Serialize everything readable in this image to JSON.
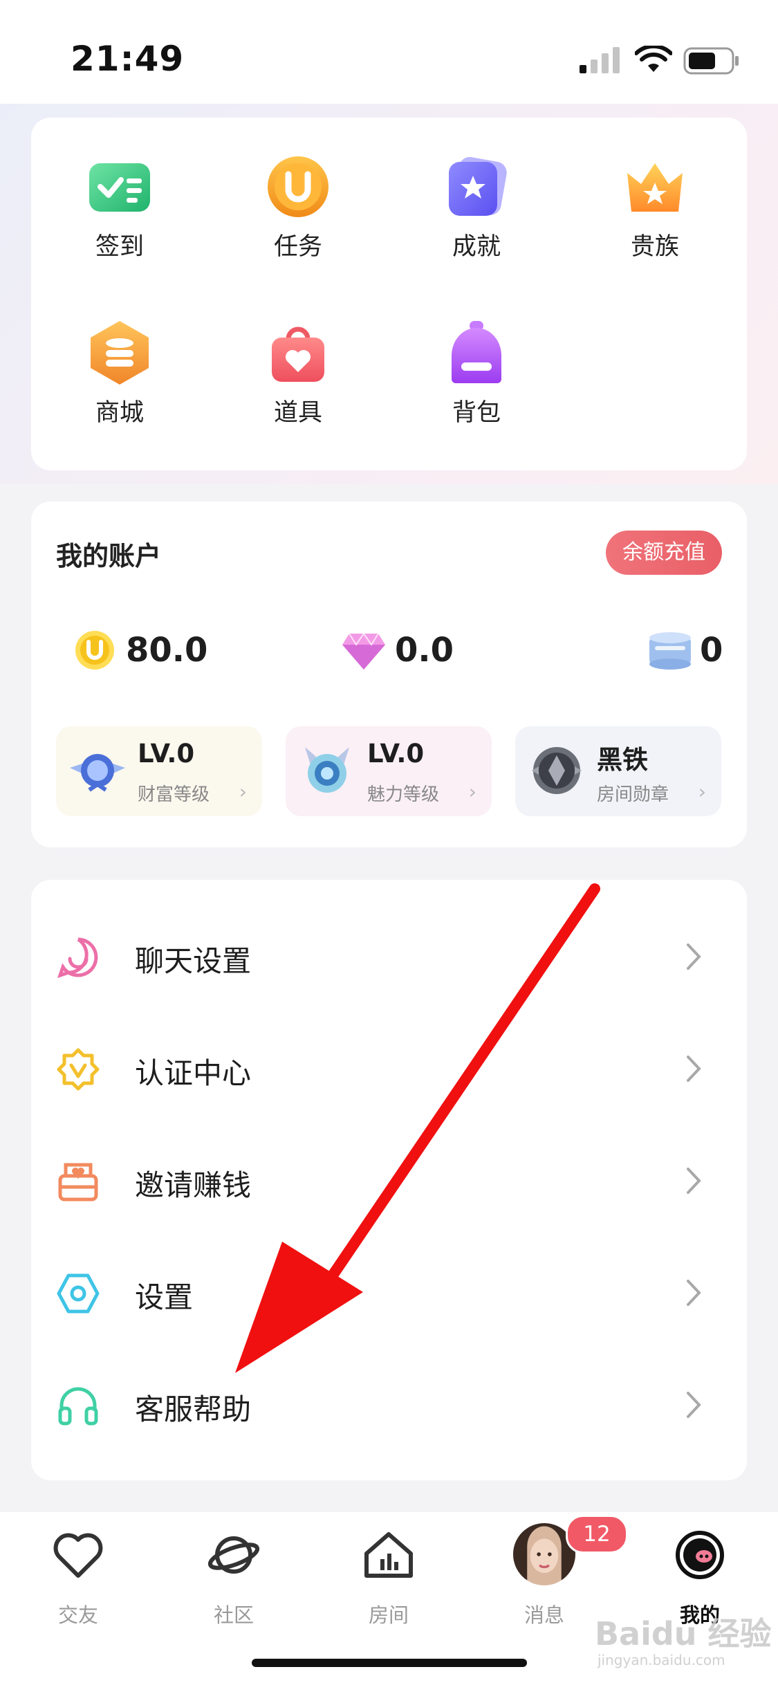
{
  "status_bar": {
    "time": "21:49"
  },
  "quick_grid": [
    {
      "label": "签到",
      "icon": "check-card-icon"
    },
    {
      "label": "任务",
      "icon": "u-coin-icon"
    },
    {
      "label": "成就",
      "icon": "star-badge-icon"
    },
    {
      "label": "贵族",
      "icon": "crown-icon"
    },
    {
      "label": "商城",
      "icon": "coin-stack-icon"
    },
    {
      "label": "道具",
      "icon": "heart-bag-icon"
    },
    {
      "label": "背包",
      "icon": "backpack-icon"
    }
  ],
  "account": {
    "title": "我的账户",
    "recharge_label": "余额充值",
    "balances": [
      {
        "icon": "gold-coin-icon",
        "value": "80.0"
      },
      {
        "icon": "diamond-icon",
        "value": "0.0"
      },
      {
        "icon": "silver-coin-icon",
        "value": "0"
      }
    ],
    "levels": [
      {
        "title": "LV.0",
        "subtitle": "财富等级"
      },
      {
        "title": "LV.0",
        "subtitle": "魅力等级"
      },
      {
        "title": "黑铁",
        "subtitle": "房间勋章"
      }
    ]
  },
  "settings_list": [
    {
      "label": "聊天设置",
      "icon": "smile-chat-icon"
    },
    {
      "label": "认证中心",
      "icon": "verified-badge-icon"
    },
    {
      "label": "邀请赚钱",
      "icon": "envelope-heart-icon"
    },
    {
      "label": "设置",
      "icon": "hex-settings-icon"
    },
    {
      "label": "客服帮助",
      "icon": "headset-icon"
    }
  ],
  "tab_bar": [
    {
      "label": "交友",
      "icon": "heart-icon",
      "active": false
    },
    {
      "label": "社区",
      "icon": "planet-icon",
      "active": false
    },
    {
      "label": "房间",
      "icon": "house-chart-icon",
      "active": false
    },
    {
      "label": "消息",
      "icon": "avatar-photo-icon",
      "active": false,
      "badge": "12"
    },
    {
      "label": "我的",
      "icon": "pig-face-icon",
      "active": true
    }
  ],
  "watermark": {
    "text": "Baidu 经验",
    "sub": "jingyan.baidu.com"
  },
  "colors": {
    "accent_red": "#e95f67",
    "badge_red": "#f15966",
    "annotation_arrow": "#f01010"
  }
}
